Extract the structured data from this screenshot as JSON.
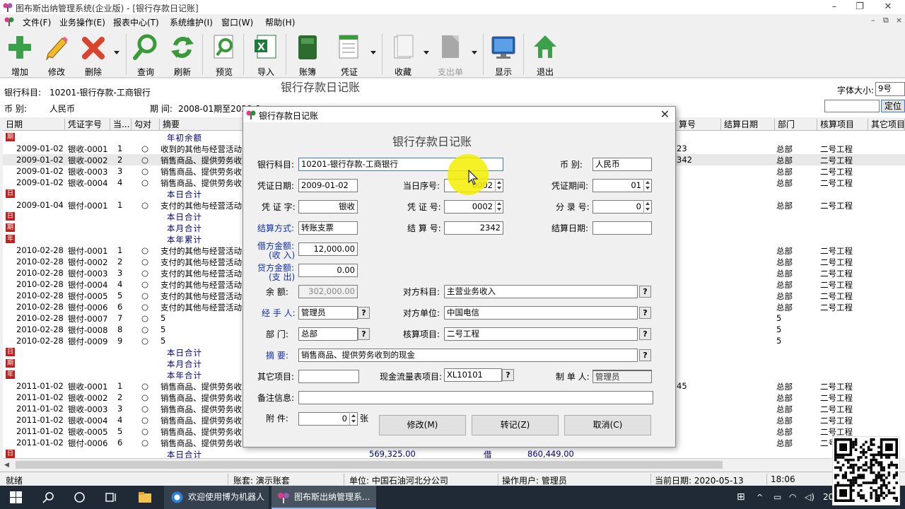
{
  "app": {
    "title": "图布斯出纳管理系统(企业版) - [银行存款日记账]",
    "colors": {
      "accent": "#1030b0",
      "summary_text": "#000080",
      "mark_red": "#b22222",
      "taskbar": "#1f2a36"
    }
  },
  "menu": {
    "items": [
      "文件(F)",
      "业务操作(E)",
      "报表中心(T)",
      "系统维护(I)",
      "窗口(W)",
      "帮助(H)"
    ],
    "mdi_controls": [
      "–",
      "⧉",
      "×"
    ]
  },
  "toolbar": {
    "buttons": [
      {
        "label": "增加",
        "icon": "plus-icon"
      },
      {
        "label": "修改",
        "icon": "pencil-icon"
      },
      {
        "label": "删除",
        "icon": "x-delete-icon"
      },
      {
        "label": "查询",
        "icon": "magnifier-icon"
      },
      {
        "label": "刷新",
        "icon": "refresh-icon"
      },
      {
        "label": "预览",
        "icon": "preview-icon"
      },
      {
        "label": "导入",
        "icon": "excel-icon"
      },
      {
        "label": "账簿",
        "icon": "ledger-book-icon"
      },
      {
        "label": "凭证",
        "icon": "voucher-icon"
      },
      {
        "label": "收藏",
        "icon": "favorite-icon"
      },
      {
        "label": "支出单",
        "icon": "expense-form-icon"
      },
      {
        "label": "显示",
        "icon": "monitor-icon"
      },
      {
        "label": "退出",
        "icon": "home-exit-icon"
      }
    ]
  },
  "info": {
    "account_label": "银行科目:",
    "account_value": "10201-银行存款-工商银行",
    "currency_label": "币  别:",
    "currency_value": "人民币",
    "period_label": "期  间:",
    "period_value": "2008-01期至2020-0",
    "report_title": "银行存款日记账",
    "font_size_label": "字体大小:",
    "font_size_value": "9号",
    "locate_button": "定位"
  },
  "grid": {
    "columns": [
      "日期",
      "凭证字号",
      "当...",
      "勾对",
      "摘要",
      "算号",
      "结算日期",
      "部门",
      "核算项目",
      "其它项目"
    ],
    "rows": [
      {
        "type": "summary",
        "text": "年初余额",
        "mark": "期"
      },
      {
        "date": "2009-01-02",
        "voucher": "银收-0001",
        "seq": "1",
        "check": "○",
        "desc": "收到的其他与经营活动",
        "settle": "23",
        "dept": "总部",
        "proj": "二号工程"
      },
      {
        "date": "2009-01-02",
        "voucher": "银收-0002",
        "seq": "2",
        "check": "○",
        "desc": "销售商品、提供劳务收",
        "settle": "342",
        "dept": "总部",
        "proj": "二号工程",
        "selected": true
      },
      {
        "date": "2009-01-02",
        "voucher": "银收-0003",
        "seq": "3",
        "check": "○",
        "desc": "销售商品、提供劳务收",
        "settle": "",
        "dept": "总部",
        "proj": "二号工程"
      },
      {
        "date": "2009-01-02",
        "voucher": "银收-0004",
        "seq": "4",
        "check": "○",
        "desc": "销售商品、提供劳务收",
        "settle": "",
        "dept": "总部",
        "proj": "二号工程"
      },
      {
        "type": "summary",
        "text": "本日合计",
        "mark": "日"
      },
      {
        "date": "2009-01-04",
        "voucher": "银付-0001",
        "seq": "1",
        "check": "○",
        "desc": "支付的其他与经营活动",
        "settle": "",
        "dept": "总部",
        "proj": "二号工程"
      },
      {
        "type": "summary",
        "text": "本日合计",
        "mark": "日"
      },
      {
        "type": "summary",
        "text": "本月合计",
        "mark": "期"
      },
      {
        "type": "summary",
        "text": "本年累计",
        "mark": "年"
      },
      {
        "date": "2010-02-28",
        "voucher": "银付-0001",
        "seq": "1",
        "check": "○",
        "desc": "支付的其他与经营活动",
        "settle": "",
        "dept": "总部",
        "proj": "二号工程"
      },
      {
        "date": "2010-02-28",
        "voucher": "银付-0002",
        "seq": "2",
        "check": "○",
        "desc": "支付的其他与经营活动",
        "settle": "",
        "dept": "总部",
        "proj": "二号工程"
      },
      {
        "date": "2010-02-28",
        "voucher": "银付-0003",
        "seq": "3",
        "check": "○",
        "desc": "支付的其他与经营活动",
        "settle": "",
        "dept": "总部",
        "proj": "二号工程"
      },
      {
        "date": "2010-02-28",
        "voucher": "银付-0004",
        "seq": "4",
        "check": "○",
        "desc": "支付的其他与经营活动",
        "settle": "",
        "dept": "总部",
        "proj": "二号工程"
      },
      {
        "date": "2010-02-28",
        "voucher": "银付-0005",
        "seq": "5",
        "check": "○",
        "desc": "支付的其他与经营活动",
        "settle": "",
        "dept": "总部",
        "proj": "二号工程"
      },
      {
        "date": "2010-02-28",
        "voucher": "银付-0006",
        "seq": "6",
        "check": "○",
        "desc": "支付的其他与经营活动",
        "settle": "",
        "dept": "总部",
        "proj": "二号工程"
      },
      {
        "date": "2010-02-28",
        "voucher": "银付-0007",
        "seq": "7",
        "check": "○",
        "desc": "5",
        "settle": "",
        "dept": "5",
        "proj": ""
      },
      {
        "date": "2010-02-28",
        "voucher": "银付-0008",
        "seq": "8",
        "check": "○",
        "desc": "5",
        "settle": "",
        "dept": "5",
        "proj": ""
      },
      {
        "date": "2010-02-28",
        "voucher": "银付-0009",
        "seq": "9",
        "check": "○",
        "desc": "5",
        "settle": "",
        "dept": "5",
        "proj": ""
      },
      {
        "type": "summary",
        "text": "本日合计",
        "mark": "日"
      },
      {
        "type": "summary",
        "text": "本月合计",
        "mark": "期"
      },
      {
        "type": "summary",
        "text": "本年合计",
        "mark": "年"
      },
      {
        "date": "2011-01-02",
        "voucher": "银收-0001",
        "seq": "1",
        "check": "○",
        "desc": "销售商品、提供劳务收",
        "settle": "45",
        "dept": "总部",
        "proj": "二号工程"
      },
      {
        "date": "2011-01-02",
        "voucher": "银收-0002",
        "seq": "2",
        "check": "○",
        "desc": "销售商品、提供劳务收",
        "settle": "",
        "dept": "总部",
        "proj": "二号工程"
      },
      {
        "date": "2011-01-02",
        "voucher": "银收-0003",
        "seq": "3",
        "check": "○",
        "desc": "销售商品、提供劳务收",
        "settle": "",
        "dept": "总部",
        "proj": "二号工程"
      },
      {
        "date": "2011-01-02",
        "voucher": "银收-0004",
        "seq": "4",
        "check": "○",
        "desc": "销售商品、提供劳务收",
        "settle": "",
        "dept": "总部",
        "proj": "二号工程"
      },
      {
        "date": "2011-01-02",
        "voucher": "银收-0005",
        "seq": "5",
        "check": "○",
        "desc": "销售商品、提供劳务收",
        "settle": "",
        "dept": "总部",
        "proj": "二号工程"
      },
      {
        "date": "2011-01-02",
        "voucher": "银付-0006",
        "seq": "6",
        "check": "○",
        "desc": "销售商品、提供劳务收",
        "settle": "",
        "dept": "总部",
        "proj": "二号"
      },
      {
        "type": "summary",
        "text": "本日合计",
        "mark": "日",
        "amount1": "569,325.00",
        "dir": "借",
        "balance": "860,449.00"
      }
    ]
  },
  "dialog": {
    "title": "银行存款日记账",
    "heading": "银行存款日记账",
    "account_label": "银行科目:",
    "account_value": "10201-银行存款-工商银行",
    "currency_label": "币  别:",
    "currency_value": "人民币",
    "voucher_date_label": "凭证日期:",
    "voucher_date_value": "2009-01-02",
    "day_seq_label": "当日序号:",
    "day_seq_value": "0002",
    "period_label": "凭证期间:",
    "period_value": "01",
    "voucher_word_label": "凭 证 字:",
    "voucher_word_value": "银收",
    "voucher_no_label": "凭 证 号:",
    "voucher_no_value": "0002",
    "entry_no_label": "分 录 号:",
    "entry_no_value": "0",
    "settle_method_label": "结算方式:",
    "settle_method_value": "转账支票",
    "settle_no_label": "结 算 号:",
    "settle_no_value": "2342",
    "settle_date_label": "结算日期:",
    "settle_date_value": "",
    "debit_label_1": "借方金额:",
    "debit_label_2": "(收 入)",
    "debit_value": "12,000.00",
    "credit_label_1": "贷方金额:",
    "credit_label_2": "(支 出)",
    "credit_value": "0.00",
    "balance_label": "余  额:",
    "balance_value": "302,000.00",
    "contra_account_label": "对方科目:",
    "contra_account_value": "主营业务收入",
    "handler_label": "经 手 人:",
    "handler_value": "管理员",
    "contra_unit_label": "对方单位:",
    "contra_unit_value": "中国电信",
    "dept_label": "部  门:",
    "dept_value": "总部",
    "project_label": "核算项目:",
    "project_value": "二号工程",
    "summary_label": "摘  要:",
    "summary_value": "销售商品、提供劳务收到的现金",
    "other_label": "其它项目:",
    "other_value": "",
    "cashflow_label": "现金流量表项目:",
    "cashflow_value": "XL10101",
    "maker_label": "制 单 人:",
    "maker_value": "管理员",
    "note_label": "备注信息:",
    "note_value": "",
    "attach_label": "附  件:",
    "attach_value": "0",
    "attach_unit": "张",
    "btn_modify": "修改(M)",
    "btn_post": "转记(Z)",
    "btn_cancel": "取消(C)"
  },
  "status": {
    "ready": "就绪",
    "book": "账套:  演示账套",
    "unit": "单位:   中国石油河北分公司",
    "user": "操作用户:   管理员",
    "date": "当前日期:   2020-05-13",
    "time": "18:06"
  },
  "taskbar": {
    "apps": [
      {
        "label": "欢迎使用博为机器人",
        "icon": "robot-app-icon"
      },
      {
        "label": "图布斯出纳管理系...",
        "icon": "tubusi-app-icon"
      }
    ],
    "tray_text": "20"
  }
}
